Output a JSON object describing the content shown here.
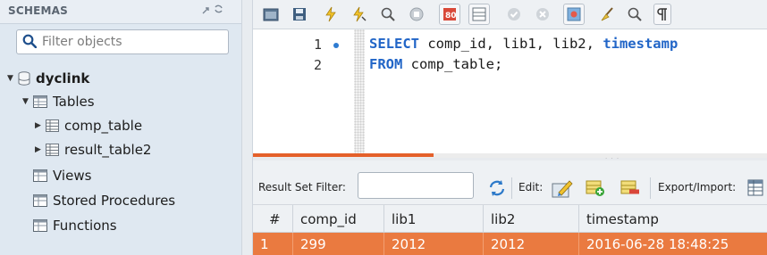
{
  "sidebar": {
    "header": "SCHEMAS",
    "filter_placeholder": "Filter objects",
    "schema_name": "dyclink",
    "tables_label": "Tables",
    "tables": [
      "comp_table",
      "result_table2"
    ],
    "views_label": "Views",
    "procedures_label": "Stored Procedures",
    "functions_label": "Functions"
  },
  "editor": {
    "line_numbers": [
      "1",
      "2"
    ],
    "line1": {
      "kw_select": "SELECT",
      "fields": " comp_id, lib1, lib2, ",
      "kw_timestamp": "timestamp"
    },
    "line2": {
      "kw_from": "FROM",
      "table": " comp_table;"
    }
  },
  "results_toolbar": {
    "filter_label": "Result Set Filter:",
    "edit_label": "Edit:",
    "export_label": "Export/Import:"
  },
  "grid": {
    "columns": [
      "#",
      "comp_id",
      "lib1",
      "lib2",
      "timestamp"
    ],
    "rows": [
      [
        "1",
        "299",
        "2012",
        "2012",
        "2016-06-28 18:48:25"
      ]
    ]
  },
  "colors": {
    "selected_row": "#ea7a40",
    "keyword": "#2165c7",
    "sidebar_bg": "#dfe8f1"
  }
}
